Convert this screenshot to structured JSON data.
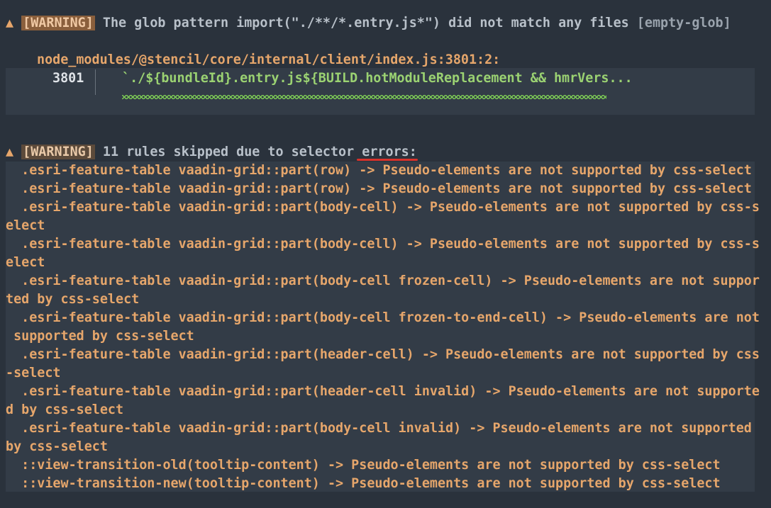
{
  "warning1": {
    "icon": "warning-triangle-icon",
    "badge": "[WARNING]",
    "message": "The glob pattern import(\"./**/*.entry.js*\") did not match any files",
    "code": "[empty-glob]",
    "location": "node_modules/@stencil/core/internal/client/index.js:3801:2:",
    "line_number": "3801",
    "source": "`./${bundleId}.entry.js${BUILD.hotModuleReplacement && hmrVers..."
  },
  "warning2": {
    "icon": "warning-triangle-icon",
    "badge": "[WARNING]",
    "message_prefix": "11 rules skipped due to selector ",
    "message_highlight": "errors:",
    "lines": [
      "  .esri-feature-table vaadin-grid::part(row) -> Pseudo-elements are not supported by css-select",
      "  .esri-feature-table vaadin-grid::part(row) -> Pseudo-elements are not supported by css-select",
      "  .esri-feature-table vaadin-grid::part(body-cell) -> Pseudo-elements are not supported by css-s",
      "elect",
      "  .esri-feature-table vaadin-grid::part(body-cell) -> Pseudo-elements are not supported by css-s",
      "elect",
      "  .esri-feature-table vaadin-grid::part(body-cell frozen-cell) -> Pseudo-elements are not suppor",
      "ted by css-select",
      "  .esri-feature-table vaadin-grid::part(body-cell frozen-to-end-cell) -> Pseudo-elements are not",
      " supported by css-select",
      "  .esri-feature-table vaadin-grid::part(header-cell) -> Pseudo-elements are not supported by css",
      "-select",
      "  .esri-feature-table vaadin-grid::part(header-cell invalid) -> Pseudo-elements are not supporte",
      "d by css-select",
      "  .esri-feature-table vaadin-grid::part(body-cell invalid) -> Pseudo-elements are not supported",
      "by css-select",
      "  ::view-transition-old(tooltip-content) -> Pseudo-elements are not supported by css-select",
      "  ::view-transition-new(tooltip-content) -> Pseudo-elements are not supported by css-select"
    ]
  }
}
